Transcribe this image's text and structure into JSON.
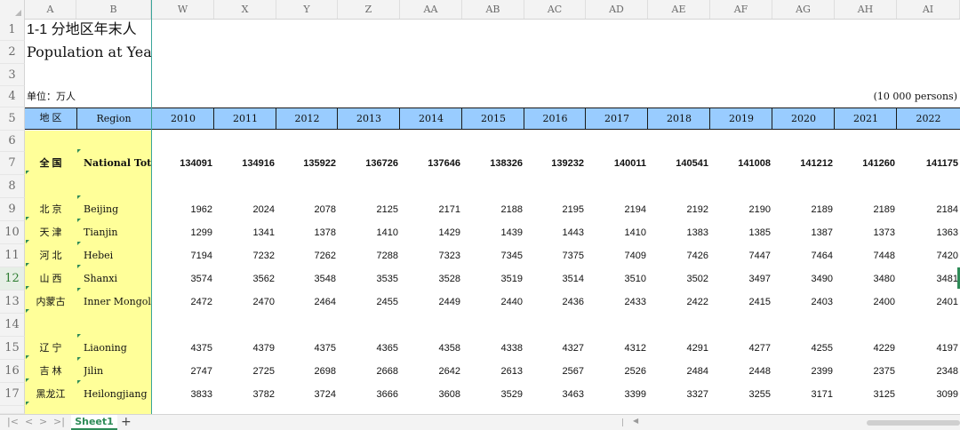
{
  "columns": {
    "frozen": [
      "A",
      "B"
    ],
    "scrolled": [
      "W",
      "X",
      "Y",
      "Z",
      "AA",
      "AB",
      "AC",
      "AD",
      "AE",
      "AF",
      "AG",
      "AH",
      "AI"
    ]
  },
  "rows": [
    "1",
    "2",
    "3",
    "4",
    "5",
    "6",
    "7",
    "8",
    "9",
    "10",
    "11",
    "12",
    "13",
    "14",
    "15",
    "16",
    "17"
  ],
  "active_row": "12",
  "title_cn": "1-1   分地区年末人",
  "title_en": "Population at Year-e",
  "unit_label": "单位：万人",
  "unit_en": "(10 000 persons)",
  "header": {
    "region_cn": "地  区",
    "region_en": "Region",
    "years": [
      "2010",
      "2011",
      "2012",
      "2013",
      "2014",
      "2015",
      "2016",
      "2017",
      "2018",
      "2019",
      "2020",
      "2021",
      "2022"
    ]
  },
  "national_total": {
    "cn": "全    国",
    "en": "National Total",
    "values": [
      "134091",
      "134916",
      "135922",
      "136726",
      "137646",
      "138326",
      "139232",
      "140011",
      "140541",
      "141008",
      "141212",
      "141260",
      "141175"
    ]
  },
  "group1": [
    {
      "cn": "北  京",
      "en": "Beijing",
      "values": [
        "1962",
        "2024",
        "2078",
        "2125",
        "2171",
        "2188",
        "2195",
        "2194",
        "2192",
        "2190",
        "2189",
        "2189",
        "2184"
      ]
    },
    {
      "cn": "天  津",
      "en": "Tianjin",
      "values": [
        "1299",
        "1341",
        "1378",
        "1410",
        "1429",
        "1439",
        "1443",
        "1410",
        "1383",
        "1385",
        "1387",
        "1373",
        "1363"
      ]
    },
    {
      "cn": "河  北",
      "en": "Hebei",
      "values": [
        "7194",
        "7232",
        "7262",
        "7288",
        "7323",
        "7345",
        "7375",
        "7409",
        "7426",
        "7447",
        "7464",
        "7448",
        "7420"
      ]
    },
    {
      "cn": "山  西",
      "en": "Shanxi",
      "values": [
        "3574",
        "3562",
        "3548",
        "3535",
        "3528",
        "3519",
        "3514",
        "3510",
        "3502",
        "3497",
        "3490",
        "3480",
        "3481"
      ]
    },
    {
      "cn": "内蒙古",
      "en": "Inner Mongolia",
      "values": [
        "2472",
        "2470",
        "2464",
        "2455",
        "2449",
        "2440",
        "2436",
        "2433",
        "2422",
        "2415",
        "2403",
        "2400",
        "2401"
      ]
    }
  ],
  "group2": [
    {
      "cn": "辽  宁",
      "en": "Liaoning",
      "values": [
        "4375",
        "4379",
        "4375",
        "4365",
        "4358",
        "4338",
        "4327",
        "4312",
        "4291",
        "4277",
        "4255",
        "4229",
        "4197"
      ]
    },
    {
      "cn": "吉  林",
      "en": "Jilin",
      "values": [
        "2747",
        "2725",
        "2698",
        "2668",
        "2642",
        "2613",
        "2567",
        "2526",
        "2484",
        "2448",
        "2399",
        "2375",
        "2348"
      ]
    },
    {
      "cn": "黑龙江",
      "en": "Heilongjiang",
      "values": [
        "3833",
        "3782",
        "3724",
        "3666",
        "3608",
        "3529",
        "3463",
        "3399",
        "3327",
        "3255",
        "3171",
        "3125",
        "3099"
      ]
    }
  ],
  "sheet_tab": "Sheet1",
  "add_sheet": "+",
  "nav": [
    "|<",
    "<",
    ">",
    ">|"
  ],
  "colors": {
    "header_blue": "#99ccff",
    "region_yellow": "#ffff99",
    "accent_green": "#2e8b57",
    "freeze_line": "#3aa59a"
  }
}
